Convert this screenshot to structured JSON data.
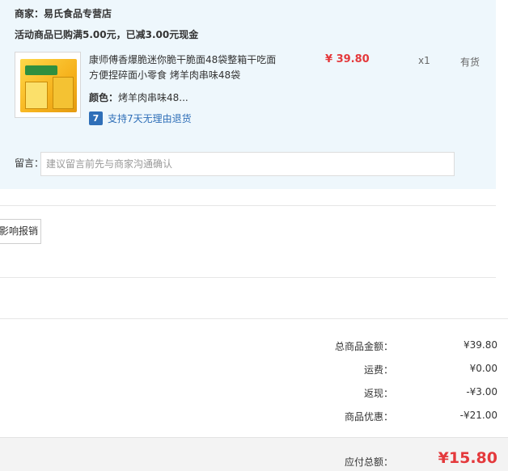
{
  "shop": {
    "name_label": "商家：易氏食品专营店",
    "promo": "活动商品已购满5.00元，已减3.00元现金"
  },
  "product": {
    "image_icon": "noodle-snack-box-image",
    "title": "康师傅香爆脆迷你脆干脆面48袋整箱干吃面方便捏碎面小零食 烤羊肉串味48袋",
    "attr_label": "颜色：",
    "attr_value": "烤羊肉串味48...",
    "return_icon_glyph": "7",
    "return_text": "支持7天无理由退货",
    "price": "¥ 39.80",
    "qty": "x1",
    "stock": "有货"
  },
  "memo": {
    "label": "留言：",
    "placeholder": "建议留言前先与商家沟通确认"
  },
  "reimburse": {
    "label": "影响报销"
  },
  "summary": {
    "rows": [
      {
        "label": "总商品金额：",
        "value": "¥39.80"
      },
      {
        "label": "运费：",
        "value": "¥0.00"
      },
      {
        "label": "返现：",
        "value": "-¥3.00"
      },
      {
        "label": "商品优惠：",
        "value": "-¥21.00"
      }
    ],
    "total_label": "应付总额：",
    "total_value": "¥15.80"
  },
  "colors": {
    "card_bg": "#eef7fc",
    "price_red": "#e4393c",
    "link_blue": "#2f6fb8"
  }
}
